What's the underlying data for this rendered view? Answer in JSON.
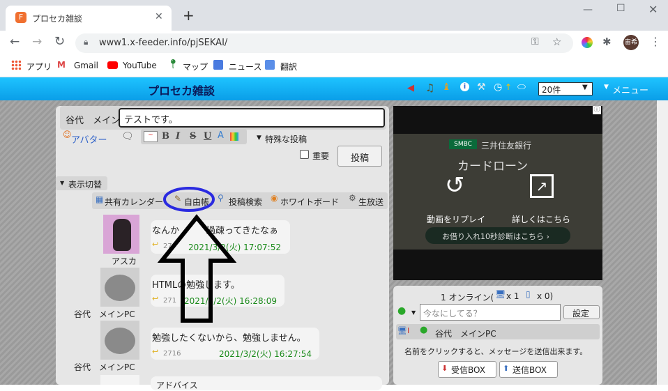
{
  "browser": {
    "tab_title": "プロセカ雑談",
    "new_tab": "+",
    "url": "www1.x-feeder.info/pjSEKAI/",
    "profile": "宙希",
    "bookmarks": [
      "アプリ",
      "Gmail",
      "YouTube",
      "マップ",
      "ニュース",
      "翻訳"
    ]
  },
  "site": {
    "title": "プロセカ雑談",
    "count_select": "20件",
    "menu": "メニュー"
  },
  "compose": {
    "name_label": "谷代　メイン",
    "message_value": "テストです。",
    "avatar_link": "アバター",
    "special_post": "特殊な投稿",
    "important_label": "重要",
    "post_button": "投稿",
    "format_buttons": [
      "B",
      "I",
      "S",
      "U"
    ]
  },
  "toggle": {
    "label": "表示切替"
  },
  "links": {
    "calendar": "共有カレンダー",
    "notebook": "自由帳",
    "search": "投稿検索",
    "whiteboard": "ホワイトボード",
    "live": "生放送"
  },
  "posts": [
    {
      "name": "アスカ",
      "text": "なんか　　　過疎ってきたなぁ",
      "num": "27",
      "date": "2021/3/2(火) 17:07:52"
    },
    {
      "name": "谷代　メインPC",
      "text": "HTMLの勉強します。",
      "num": "271",
      "date": "2021/3/2(火) 16:28:09"
    },
    {
      "name": "谷代　メインPC",
      "text": "勉強したくないから、勉強しません。",
      "num": "2716",
      "date": "2021/3/2(火) 16:27:54"
    },
    {
      "name": "",
      "text": "アドバイス",
      "num": "",
      "date": ""
    }
  ],
  "ad": {
    "bank": "三井住友銀行",
    "bank_short": "SMBC",
    "product": "カードローン",
    "replay": "動画をリプレイ",
    "details": "詳しくはこちら",
    "cta": "お借り入れ10秒診断はこちら ›"
  },
  "online": {
    "summary": "1 オンライン(",
    "pc_count": "x 1",
    "mobile_count": "x 0)",
    "status_placeholder": "今なにしてる？",
    "set_button": "設定",
    "user": "谷代　メインPC",
    "hint": "名前をクリックすると、メッセージを送信出来ます。",
    "inbox": "受信BOX",
    "outbox": "送信BOX"
  },
  "colors": {
    "header_blue": "#0a9ee8",
    "annotation_circle": "#2a2ae0",
    "date_green": "#1a8a1a"
  }
}
